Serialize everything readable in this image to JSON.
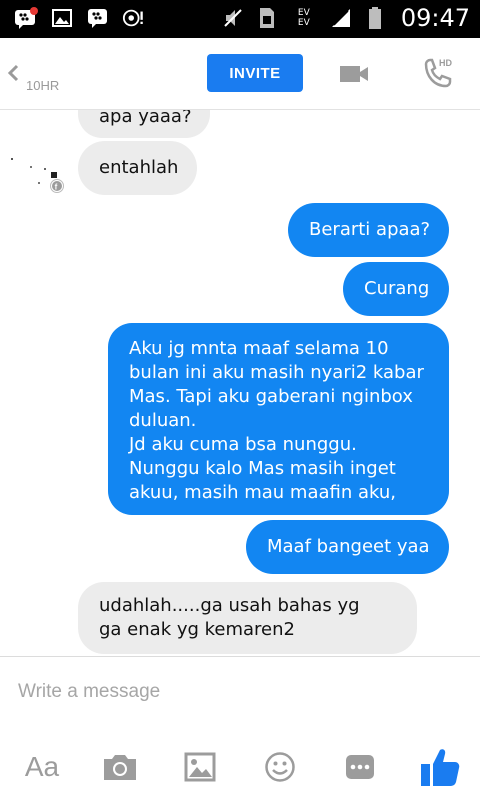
{
  "status_bar": {
    "time": "09:47",
    "network_top": "EV",
    "network_bottom": "EV",
    "icons": [
      "bbm-notification-icon",
      "gallery-icon",
      "bbm-icon",
      "media-icon",
      "mute-icon",
      "sim-icon",
      "data-arrows-icon",
      "signal-icon",
      "battery-icon"
    ]
  },
  "header": {
    "time_ago": "10HR",
    "invite_label": "INVITE",
    "call_badge": "HD"
  },
  "messages": [
    {
      "side": "in",
      "text": "apa yaaa?"
    },
    {
      "side": "in",
      "text": "entahlah"
    },
    {
      "side": "out",
      "text": "Berarti apaa?"
    },
    {
      "side": "out",
      "text": "Curang"
    },
    {
      "side": "out",
      "lines": [
        "Aku jg mnta maaf selama 10",
        "bulan ini aku masih nyari2 kabar",
        "Mas. Tapi aku gaberani nginbox",
        "duluan.",
        "Jd aku cuma bsa nunggu.",
        "Nunggu kalo Mas masih inget",
        "akuu, masih mau maafin aku,"
      ]
    },
    {
      "side": "out",
      "text": "Maaf bangeet yaa"
    },
    {
      "side": "in",
      "lines": [
        "udahlah.....ga usah bahas yg",
        "ga enak yg kemaren2"
      ]
    }
  ],
  "composer": {
    "placeholder": "Write a message",
    "text_tool_label": "Aa"
  },
  "colors": {
    "accent": "#1a7cf0",
    "outgoing_bubble": "#1286f2",
    "incoming_bubble": "#ececec",
    "icon_gray": "#9c9c9c"
  }
}
